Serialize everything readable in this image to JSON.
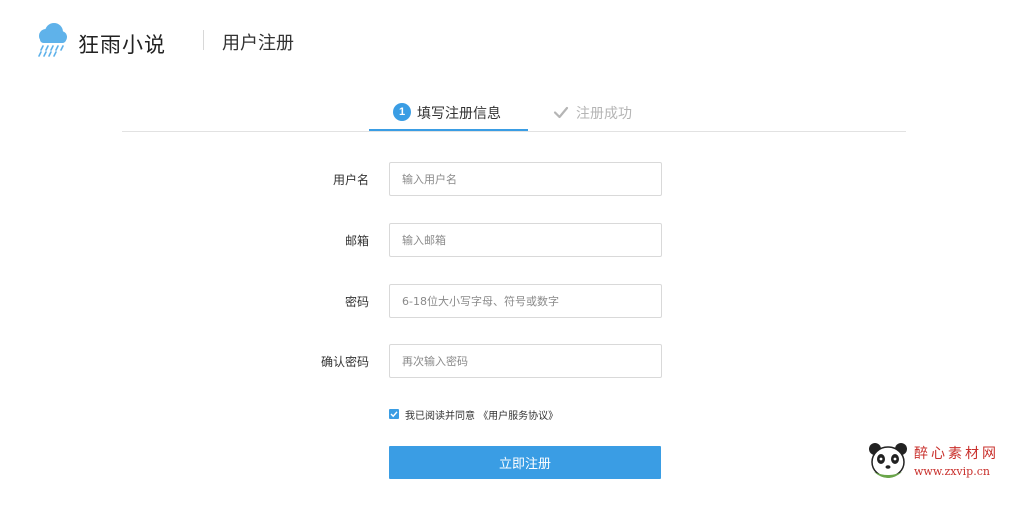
{
  "header": {
    "brand": "狂雨小说",
    "page_title": "用户注册"
  },
  "steps": [
    {
      "number": "1",
      "label": "填写注册信息",
      "state": "active"
    },
    {
      "label": "注册成功",
      "state": "pending",
      "icon": "check-icon"
    }
  ],
  "form": {
    "fields": [
      {
        "label": "用户名",
        "placeholder": "输入用户名",
        "value": ""
      },
      {
        "label": "邮箱",
        "placeholder": "输入邮箱",
        "value": ""
      },
      {
        "label": "密码",
        "placeholder": "6-18位大小写字母、符号或数字",
        "value": ""
      },
      {
        "label": "确认密码",
        "placeholder": "再次输入密码",
        "value": ""
      }
    ],
    "agreement": {
      "checked": true,
      "text": "我已阅读并同意",
      "link": "《用户服务协议》"
    },
    "submit_label": "立即注册"
  },
  "watermark": {
    "title": "醉心素材网",
    "url": "www.zxvip.cn"
  },
  "colors": {
    "accent": "#3a9de4",
    "text": "#333333",
    "muted": "#b5b5b5",
    "border": "#d9d9d9",
    "watermark": "#c9302c"
  }
}
